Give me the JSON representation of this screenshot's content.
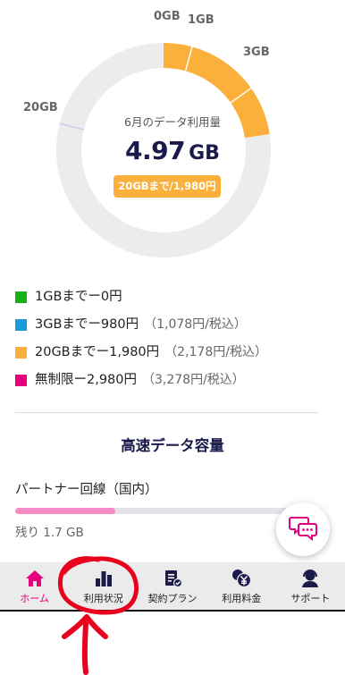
{
  "colors": {
    "accent": "#e6007e",
    "navy": "#1a1a4b",
    "annotation": "#e8001c"
  },
  "usage": {
    "ticks": {
      "t0": "0GB",
      "t1": "1GB",
      "t3": "3GB",
      "t20": "20GB"
    },
    "title": "6月のデータ利用量",
    "value": "4.97",
    "unit": "GB",
    "plan_badge": "20GBまで/1,980円",
    "used_gb": 4.97
  },
  "legend": [
    {
      "label": "1GBまでー0円",
      "note": "",
      "color": "#18b218"
    },
    {
      "label": "3GBまでー980円",
      "note": "（1,078円/税込）",
      "color": "#1a9ad9"
    },
    {
      "label": "20GBまでー1,980円",
      "note": "（2,178円/税込）",
      "color": "#fbb03b"
    },
    {
      "label": "無制限ー2,980円",
      "note": "（3,278円/税込）",
      "color": "#e6007e"
    }
  ],
  "speed": {
    "title": "高速データ容量",
    "line_label": "パートナー回線（国内）",
    "remaining_label": "残り 1.7 GB",
    "fill_fraction": 0.34
  },
  "nav": {
    "items": [
      {
        "label": "ホーム",
        "icon": "home-icon"
      },
      {
        "label": "利用状況",
        "icon": "usage-chart-icon"
      },
      {
        "label": "契約プラン",
        "icon": "contract-plan-icon"
      },
      {
        "label": "利用料金",
        "icon": "yen-fee-icon"
      },
      {
        "label": "サポート",
        "icon": "support-agent-icon"
      }
    ],
    "active_index": 0
  }
}
